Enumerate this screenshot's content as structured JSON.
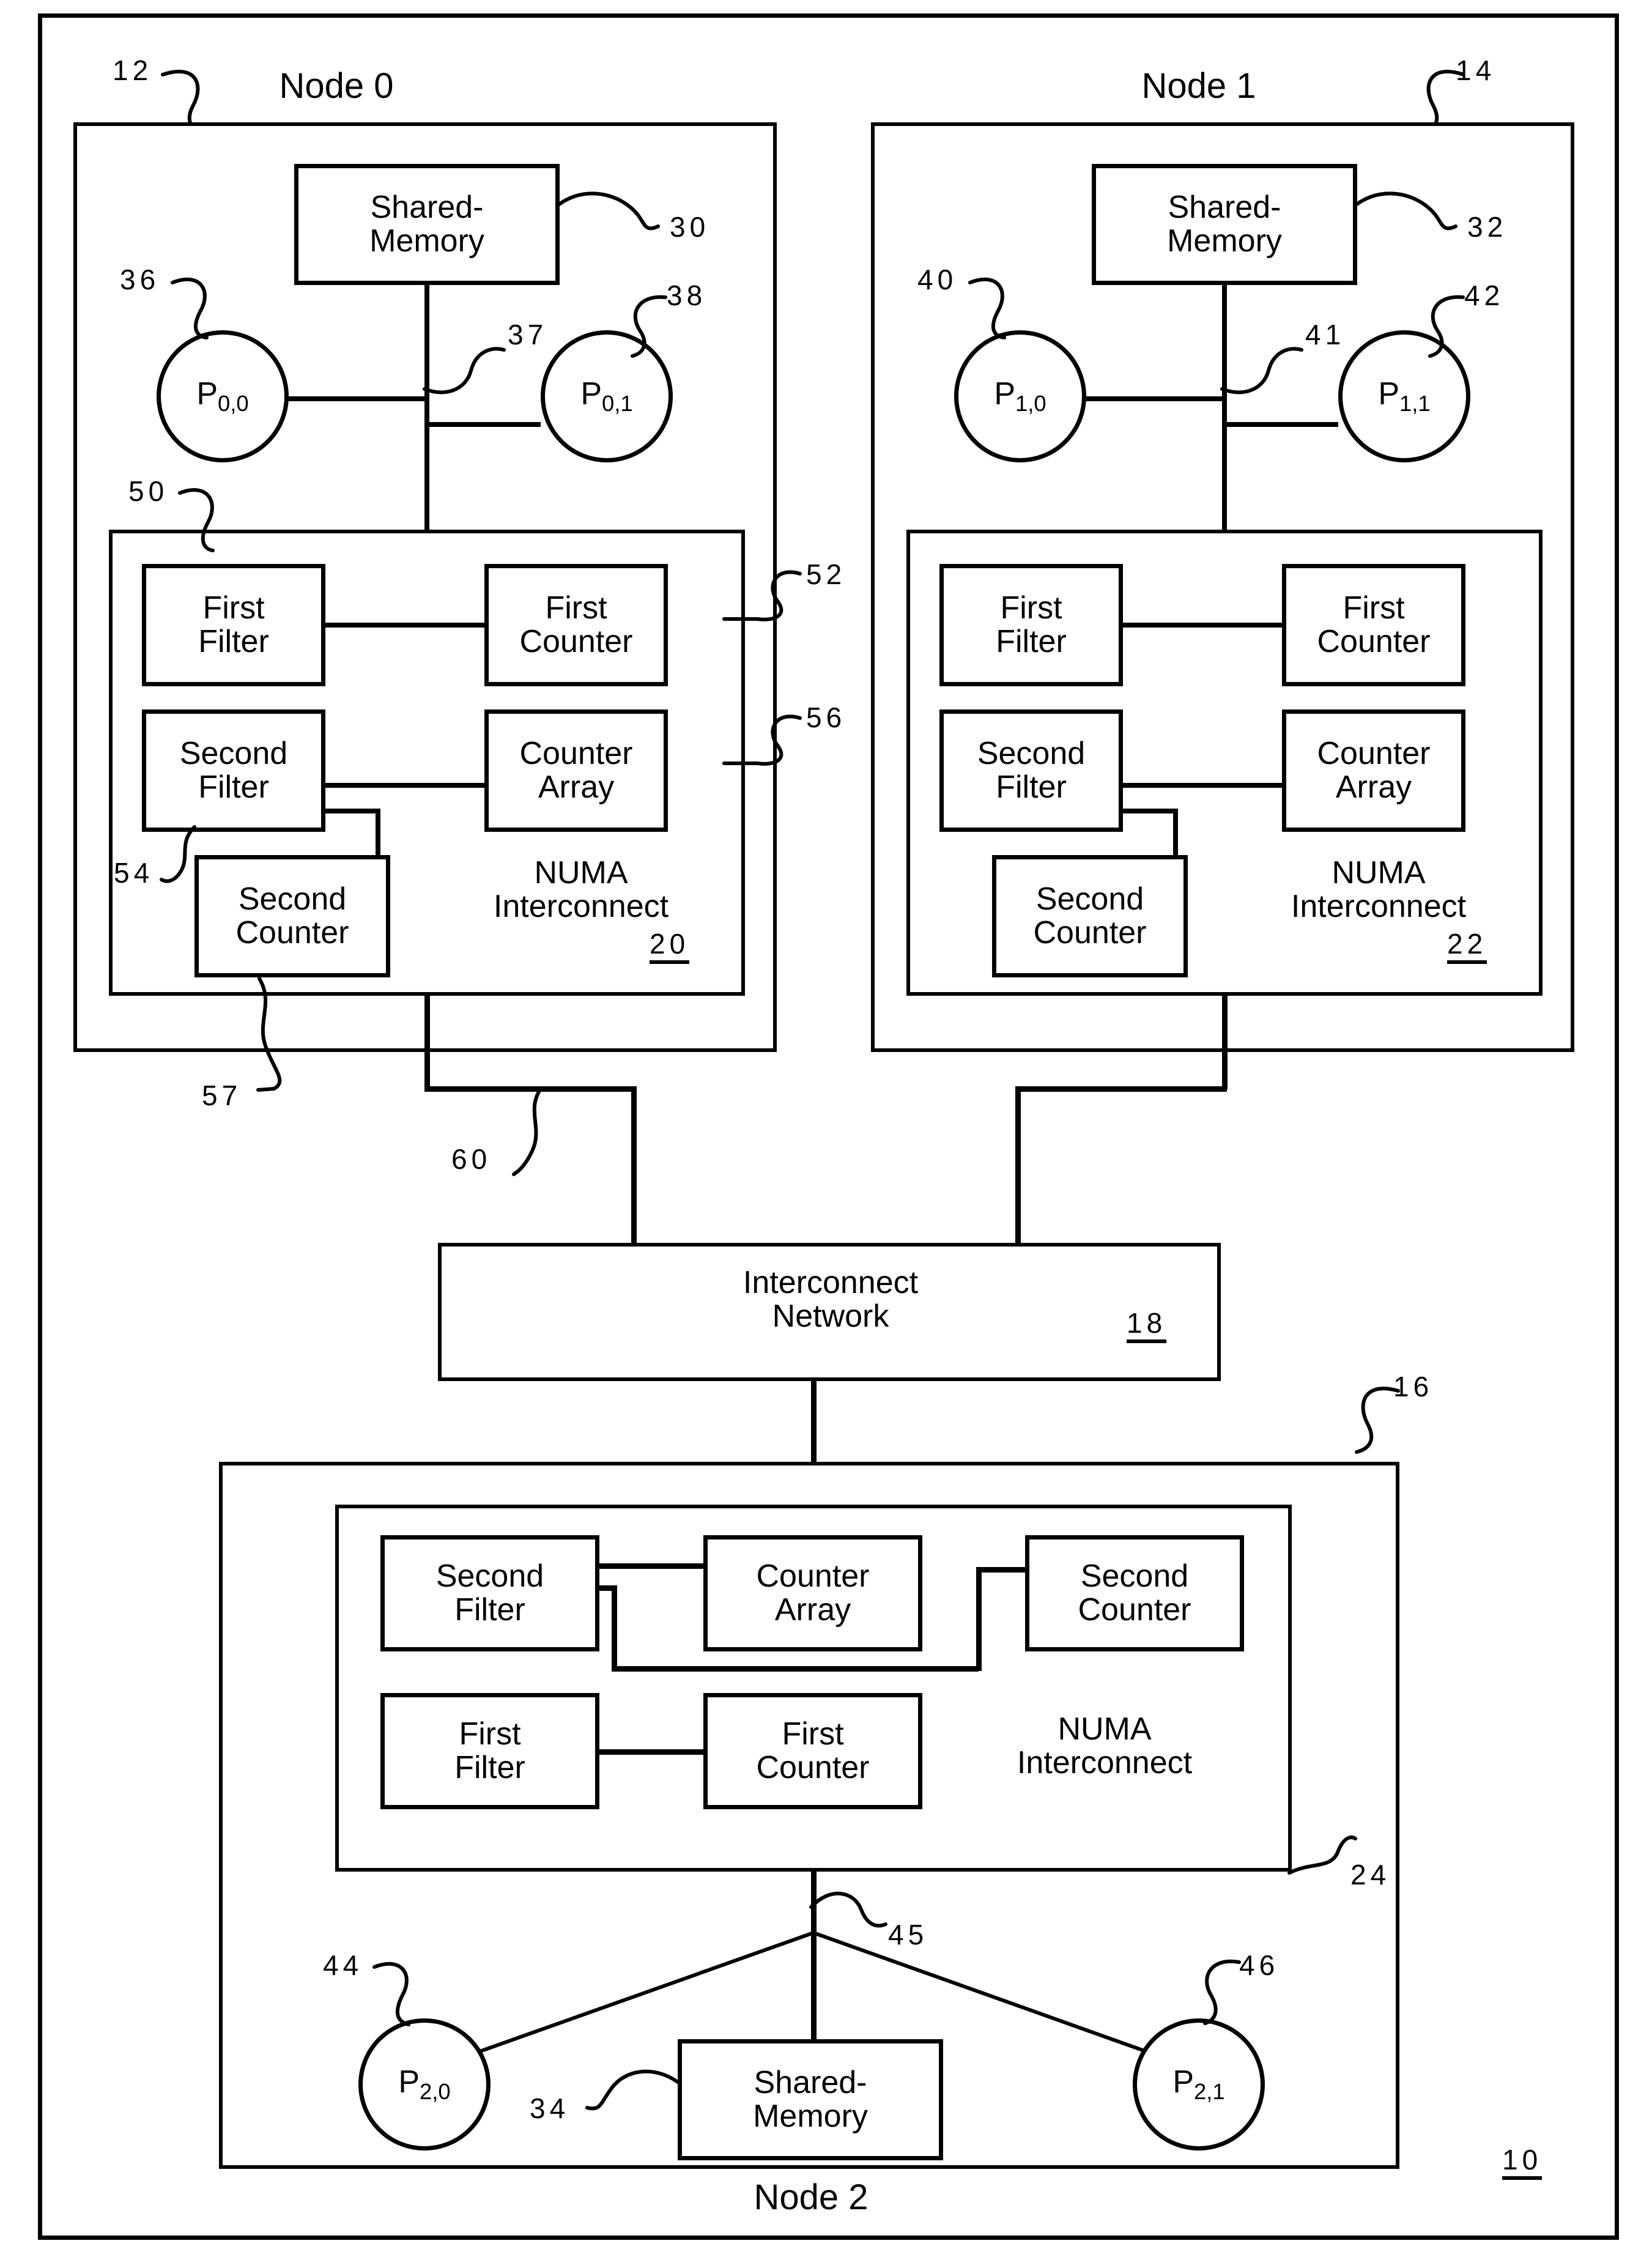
{
  "figure": {
    "number": "10",
    "outer_frame": true
  },
  "nodes": [
    {
      "title": "Node 0",
      "ref": "12",
      "shared_memory": {
        "label": "Shared-\nMemory",
        "ref": "30"
      },
      "bus_ref": "37",
      "processors": [
        {
          "base": "P",
          "sub": "0,0",
          "ref": "36"
        },
        {
          "base": "P",
          "sub": "0,1",
          "ref": "38"
        }
      ],
      "interconnect": {
        "title": "NUMA\nInterconnect",
        "num": "20",
        "ref": "50",
        "blocks": [
          {
            "label": "First\nFilter",
            "ref": ""
          },
          {
            "label": "First\nCounter",
            "ref": "52"
          },
          {
            "label": "Second\nFilter",
            "ref": "54"
          },
          {
            "label": "Counter\nArray",
            "ref": "56"
          },
          {
            "label": "Second\nCounter",
            "ref": "57"
          }
        ]
      }
    },
    {
      "title": "Node 1",
      "ref": "14",
      "shared_memory": {
        "label": "Shared-\nMemory",
        "ref": "32"
      },
      "bus_ref": "41",
      "processors": [
        {
          "base": "P",
          "sub": "1,0",
          "ref": "40"
        },
        {
          "base": "P",
          "sub": "1,1",
          "ref": "42"
        }
      ],
      "interconnect": {
        "title": "NUMA\nInterconnect",
        "num": "22",
        "ref": "",
        "blocks": [
          {
            "label": "First\nFilter",
            "ref": ""
          },
          {
            "label": "First\nCounter",
            "ref": ""
          },
          {
            "label": "Second\nFilter",
            "ref": ""
          },
          {
            "label": "Counter\nArray",
            "ref": ""
          },
          {
            "label": "Second\nCounter",
            "ref": ""
          }
        ]
      }
    },
    {
      "title": "Node 2",
      "ref": "16",
      "shared_memory": {
        "label": "Shared-\nMemory",
        "ref": "34"
      },
      "bus_ref": "45",
      "processors": [
        {
          "base": "P",
          "sub": "2,0",
          "ref": "44"
        },
        {
          "base": "P",
          "sub": "2,1",
          "ref": "46"
        }
      ],
      "interconnect": {
        "title": "NUMA\nInterconnect",
        "num": "",
        "ref": "24",
        "blocks": [
          {
            "label": "Second\nFilter",
            "ref": ""
          },
          {
            "label": "Counter\nArray",
            "ref": ""
          },
          {
            "label": "Second\nCounter",
            "ref": ""
          },
          {
            "label": "First\nFilter",
            "ref": ""
          },
          {
            "label": "First\nCounter",
            "ref": ""
          }
        ]
      }
    }
  ],
  "interconnect_network": {
    "label": "Interconnect\nNetwork",
    "num": "18",
    "link_ref": "60"
  }
}
